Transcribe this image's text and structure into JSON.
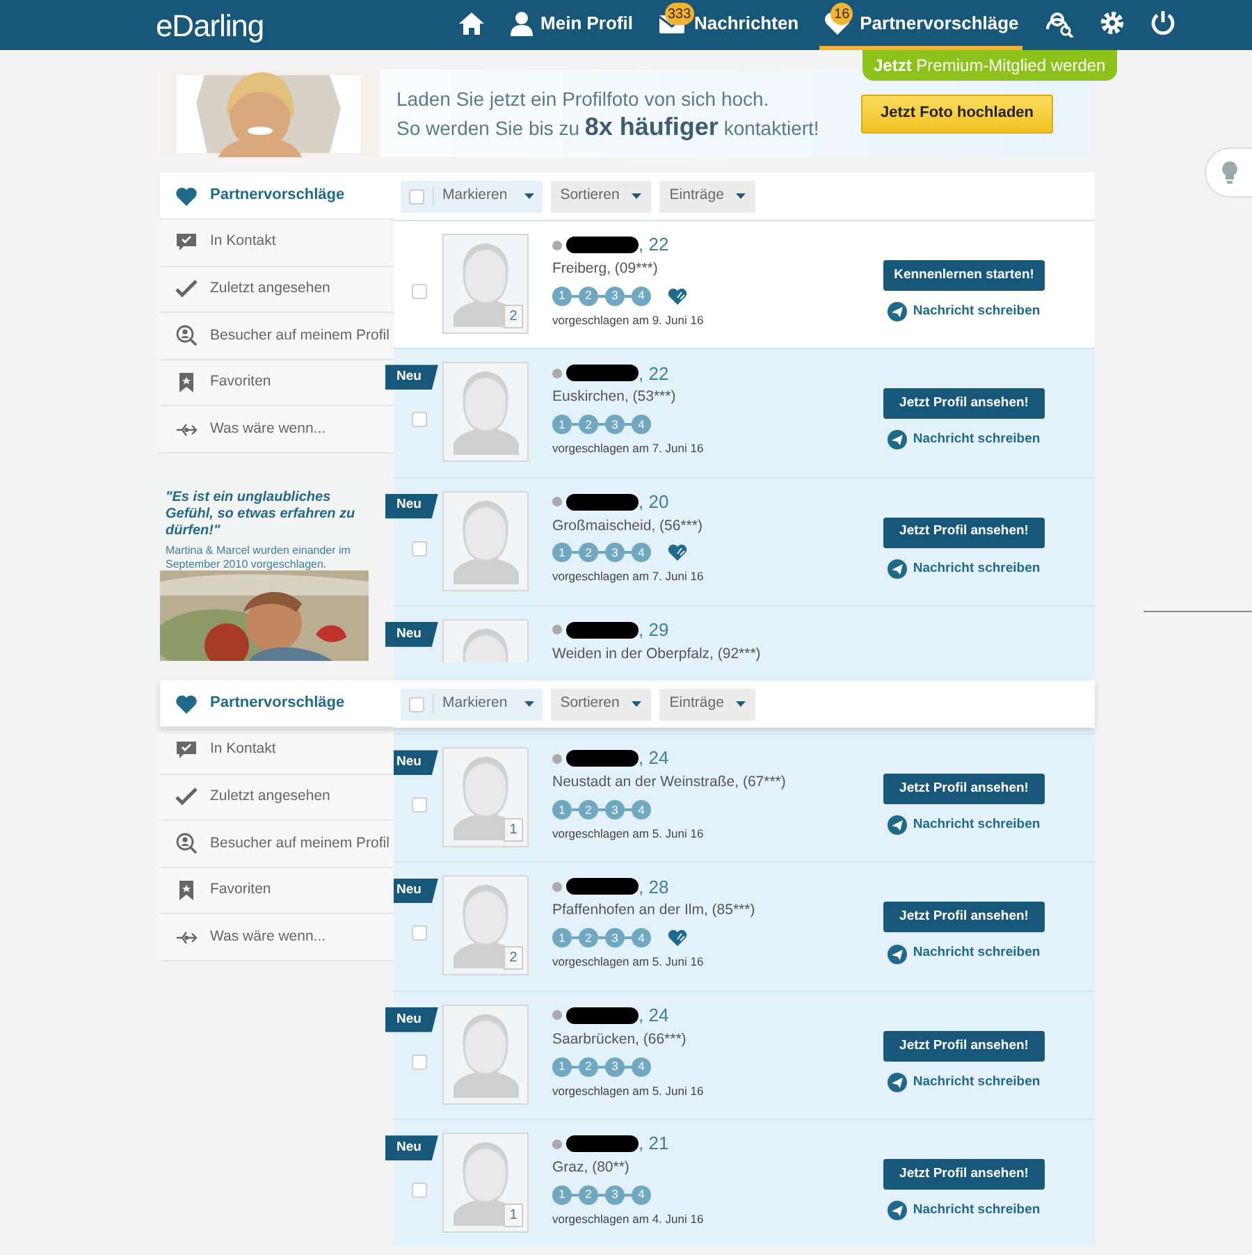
{
  "nav": {
    "logo": "eDarling",
    "items": [
      {
        "kind": "home",
        "selected": false
      },
      {
        "kind": "profile",
        "label": "Mein Profil",
        "selected": false
      },
      {
        "kind": "messages",
        "label": "Nachrichten",
        "badge": "333",
        "selected": false
      },
      {
        "kind": "matches",
        "label": "Partnervorschläge",
        "badge": "16",
        "selected": true
      },
      {
        "kind": "search",
        "selected": false
      },
      {
        "kind": "settings",
        "selected": false
      },
      {
        "kind": "power",
        "selected": false
      }
    ]
  },
  "premium_tab": "**Jetzt** Premium-Mitglied werden",
  "banner": {
    "lines": [
      "Laden Sie jetzt ein Profilfoto von sich hoch.",
      "So werden Sie bis zu **8x häufiger** kontaktiert!"
    ],
    "button": "Jetzt Foto hochladen"
  },
  "sidebar": {
    "items": [
      {
        "kind": "heart",
        "label": "Partnervorschläge",
        "selected": true
      },
      {
        "kind": "chat",
        "label": "In Kontakt",
        "selected": false
      },
      {
        "kind": "check",
        "label": "Zuletzt angesehen",
        "selected": false
      },
      {
        "kind": "visitor",
        "label": "Besucher auf meinem Profil",
        "selected": false
      },
      {
        "kind": "bookmark",
        "label": "Favoriten",
        "selected": false
      },
      {
        "kind": "whatif",
        "label": "Was wäre wenn...",
        "selected": false
      }
    ],
    "promo": {
      "quote": "\"Es ist ein unglaubliches Gefühl, so etwas erfahren zu dürfen!\"",
      "caption": "Martina & Marcel wurden einander im September 2010 vorgeschlagen."
    }
  },
  "toolbar": [
    {
      "kind": "select",
      "label": "Markieren",
      "checked": false
    },
    {
      "kind": "dropdown",
      "label": "Sortieren"
    },
    {
      "kind": "dropdown",
      "label": "Einträge"
    }
  ],
  "rows": [
    {
      "new": false,
      "checked": false,
      "age": ", 22",
      "location": "Freiberg, (09***)",
      "photos": "2",
      "steps": [
        "1",
        "2",
        "3",
        "4"
      ],
      "heart": true,
      "date": "vorgeschlagen am 9. Juni 16",
      "button": "Kennenlernen starten!",
      "link": "Nachricht schreiben"
    },
    {
      "new": true,
      "badge": "Neu",
      "checked": false,
      "age": ", 22",
      "location": "Euskirchen, (53***)",
      "steps": [
        "1",
        "2",
        "3",
        "4"
      ],
      "heart": false,
      "date": "vorgeschlagen am 7. Juni 16",
      "button": "Jetzt Profil ansehen!",
      "link": "Nachricht schreiben"
    },
    {
      "new": true,
      "badge": "Neu",
      "checked": false,
      "age": ", 20",
      "location": "Großmaischeid, (56***)",
      "steps": [
        "1",
        "2",
        "3",
        "4"
      ],
      "heart": true,
      "date": "vorgeschlagen am 7. Juni 16",
      "button": "Jetzt Profil ansehen!",
      "link": "Nachricht schreiben"
    },
    {
      "new": true,
      "badge": "Neu",
      "age": ", 29",
      "location": "Weiden in der Oberpfalz, (92***)"
    },
    {
      "new": true,
      "badge": "Neu",
      "checked": false,
      "age": ", 24",
      "location": "Neustadt an der Weinstraße, (67***)",
      "photos": "1",
      "steps": [
        "1",
        "2",
        "3",
        "4"
      ],
      "heart": false,
      "date": "vorgeschlagen am 5. Juni 16",
      "button": "Jetzt Profil ansehen!",
      "link": "Nachricht schreiben"
    },
    {
      "new": true,
      "badge": "Neu",
      "checked": false,
      "age": ", 28",
      "location": "Pfaffenhofen an der Ilm, (85***)",
      "photos": "2",
      "steps": [
        "1",
        "2",
        "3",
        "4"
      ],
      "heart": true,
      "date": "vorgeschlagen am 5. Juni 16",
      "button": "Jetzt Profil ansehen!",
      "link": "Nachricht schreiben"
    },
    {
      "new": true,
      "badge": "Neu",
      "checked": false,
      "age": ", 24",
      "location": "Saarbrücken, (66***)",
      "steps": [
        "1",
        "2",
        "3",
        "4"
      ],
      "heart": false,
      "date": "vorgeschlagen am 5. Juni 16",
      "button": "Jetzt Profil ansehen!",
      "link": "Nachricht schreiben"
    },
    {
      "new": true,
      "badge": "Neu",
      "checked": false,
      "age": ", 21",
      "location": "Graz, (80**)",
      "photos": "1",
      "steps": [
        "1",
        "2",
        "3",
        "4"
      ],
      "heart": false,
      "date": "vorgeschlagen am 4. Juni 16",
      "button": "Jetzt Profil ansehen!",
      "link": "Nachricht schreiben"
    }
  ],
  "sticky": {
    "sidebar_items": [
      {
        "kind": "heart",
        "label": "Partnervorschläge",
        "selected": true
      },
      {
        "kind": "chat",
        "label": "In Kontakt",
        "selected": false
      },
      {
        "kind": "check",
        "label": "Zuletzt angesehen",
        "selected": false
      },
      {
        "kind": "visitor",
        "label": "Besucher auf meinem Profil",
        "selected": false
      },
      {
        "kind": "bookmark",
        "label": "Favoriten",
        "selected": false
      },
      {
        "kind": "whatif",
        "label": "Was wäre wenn...",
        "selected": false
      }
    ],
    "toolbar": [
      {
        "kind": "select",
        "label": "Markieren",
        "checked": false
      },
      {
        "kind": "dropdown",
        "label": "Sortieren"
      },
      {
        "kind": "dropdown",
        "label": "Einträge"
      }
    ]
  }
}
